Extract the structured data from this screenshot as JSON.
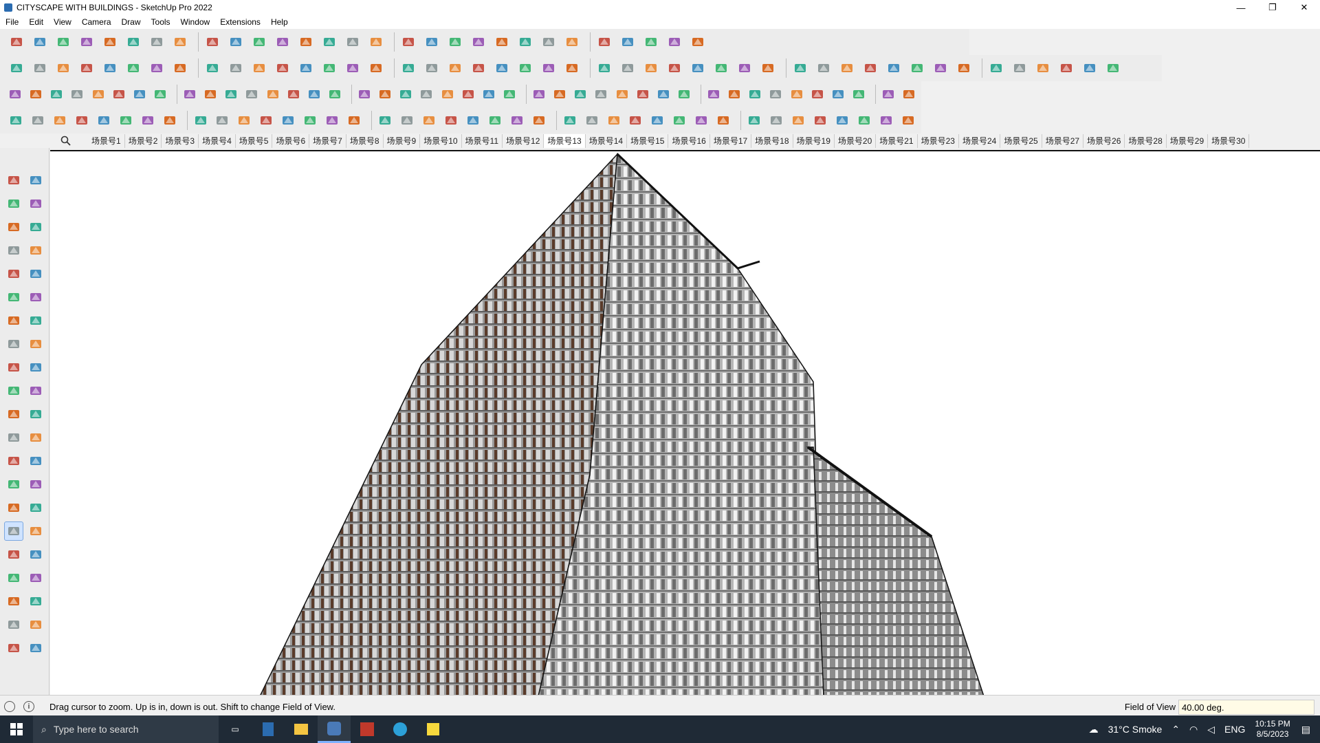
{
  "window": {
    "title": "CITYSCAPE WITH BUILDINGS - SketchUp Pro 2022"
  },
  "window_controls": {
    "minimize": "—",
    "restore": "❐",
    "close": "✕"
  },
  "menu": [
    "File",
    "Edit",
    "View",
    "Camera",
    "Draw",
    "Tools",
    "Window",
    "Extensions",
    "Help"
  ],
  "scenes": {
    "active_index": 12,
    "tabs": [
      "场景号1",
      "场景号2",
      "场景号3",
      "场景号4",
      "场景号5",
      "场景号6",
      "场景号7",
      "场景号8",
      "场景号9",
      "场景号10",
      "场景号11",
      "场景号12",
      "场景号13",
      "场景号14",
      "场景号15",
      "场景号16",
      "场景号17",
      "场景号18",
      "场景号19",
      "场景号20",
      "场景号21",
      "场景号23",
      "场景号24",
      "场景号25",
      "场景号27",
      "场景号26",
      "场景号28",
      "场景号29",
      "场景号30"
    ]
  },
  "status": {
    "hint": "Drag cursor to zoom.  Up is in, down is out. Shift to change Field of View.",
    "vcb_label": "Field of View",
    "vcb_value": "40.00 deg."
  },
  "taskbar": {
    "search_placeholder": "Type here to search",
    "weather": "31°C  Smoke",
    "lang": "ENG",
    "time": "10:15 PM",
    "date": "8/5/2023"
  },
  "colors": {
    "accent": "#2b6cb0",
    "building_main": "#b9b9b9",
    "building_dark": "#5a3b2a",
    "taskbar": "#1f2a36"
  },
  "icons": [
    "zoom-icon",
    "select-icon",
    "eraser-icon",
    "pencil-icon",
    "arc-icon",
    "rectangle-icon",
    "push-pull-icon",
    "move-icon",
    "rotate-icon",
    "scale-icon",
    "tape-icon",
    "text-icon",
    "paint-icon",
    "orbit-icon",
    "pan-icon",
    "zoom-window-icon",
    "zoom-extents-icon",
    "undo-icon",
    "redo-icon"
  ]
}
